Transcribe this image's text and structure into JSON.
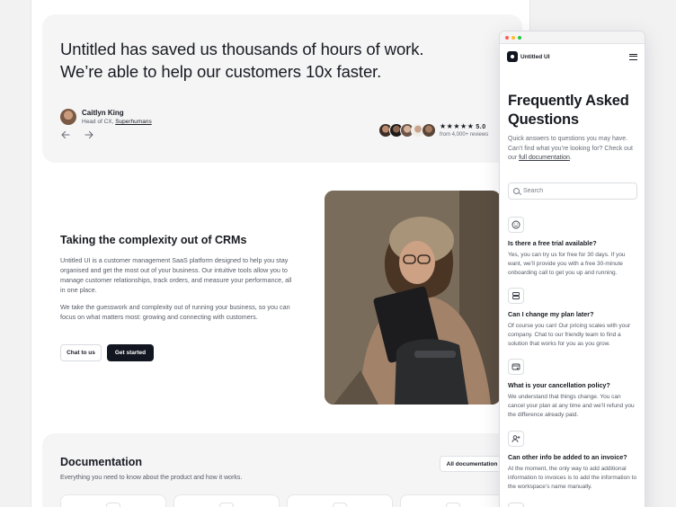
{
  "testimonial": {
    "quote_line1": "Untitled has saved us thousands of hours of work.",
    "quote_line2": "We’re able to help our customers 10x faster.",
    "author_name": "Caitlyn King",
    "author_role_prefix": "Head of CX, ",
    "author_company": "Superhumans",
    "prev_icon": "arrow-left-icon",
    "next_icon": "arrow-right-icon",
    "stars": "★★★★★",
    "rating": "5.0",
    "reviews_text": "from 4,000+ reviews"
  },
  "crm": {
    "title": "Taking the complexity out of CRMs",
    "paragraph1": "Untitled UI is a customer management SaaS platform designed to help you stay organised and get the most out of your business. Our intuitive tools allow you to manage customer relationships, track orders, and measure your performance, all in one place.",
    "paragraph2": "We take the guesswork and complexity out of running your business, so you can focus on what matters most: growing and connecting with customers.",
    "chat_button": "Chat to us",
    "start_button": "Get started"
  },
  "docs": {
    "title": "Documentation",
    "subtitle": "Everything you need to know about the product and how it works.",
    "all_button": "All documentation"
  },
  "mobile": {
    "brand": "Untitled UI",
    "title": "Frequently Asked Questions",
    "desc_prefix": "Quick answers to questions you may have. Can’t find what you’re looking for? Check out our ",
    "desc_link": "full documentation",
    "desc_suffix": ".",
    "search_placeholder": "Search",
    "faqs": [
      {
        "icon": "smile-icon",
        "question": "Is there a free trial available?",
        "answer": "Yes, you can try us for free for 30 days. If you want, we’ll provide you with a free 30-minute onboarding call to get you up and running."
      },
      {
        "icon": "layers-icon",
        "question": "Can I change my plan later?",
        "answer": "Of course you can! Our pricing scales with your company. Chat to our friendly team to find a solution that works for you as you grow."
      },
      {
        "icon": "card-x-icon",
        "question": "What is your cancellation policy?",
        "answer": "We understand that things change. You can cancel your plan at any time and we’ll refund you the difference already paid."
      },
      {
        "icon": "user-plus-icon",
        "question": "Can other info be added to an invoice?",
        "answer": "At the moment, the only way to add additional information to invoices is to add the information to the workspace’s name manually."
      }
    ]
  },
  "colors": {
    "primary_dark": "#121620",
    "surface": "#f5f5f6",
    "dot_red": "#ff5f57",
    "dot_yellow": "#febc2e",
    "dot_green": "#28c840"
  }
}
